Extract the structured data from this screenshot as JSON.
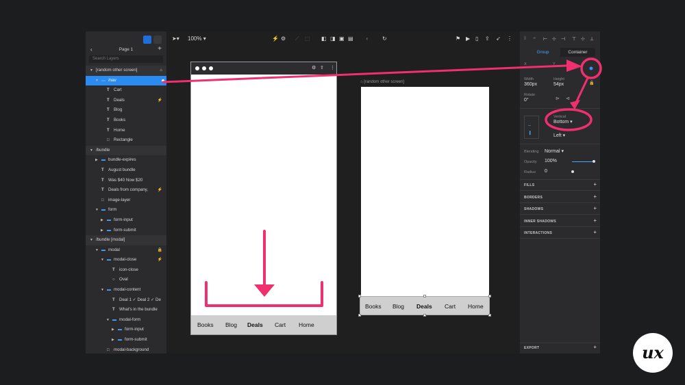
{
  "layers_panel": {
    "page_name": "Page 1",
    "search_placeholder": "Search Layers",
    "rows": [
      {
        "label": "[random other screen]",
        "depth": 0,
        "icon": "",
        "caret": "▼",
        "group": true,
        "badge": "⌂",
        "selected": false
      },
      {
        "label": "/nav",
        "depth": 1,
        "icon": "folder",
        "caret": "▼",
        "group": false,
        "badge": "",
        "selected": true
      },
      {
        "label": "Cart",
        "depth": 2,
        "icon": "T",
        "caret": "",
        "group": false,
        "badge": "",
        "selected": false
      },
      {
        "label": "Deals",
        "depth": 2,
        "icon": "T",
        "caret": "",
        "group": false,
        "badge": "⚡",
        "selected": false
      },
      {
        "label": "Blog",
        "depth": 2,
        "icon": "T",
        "caret": "",
        "group": false,
        "badge": "",
        "selected": false
      },
      {
        "label": "Books",
        "depth": 2,
        "icon": "T",
        "caret": "",
        "group": false,
        "badge": "",
        "selected": false
      },
      {
        "label": "Home",
        "depth": 2,
        "icon": "T",
        "caret": "",
        "group": false,
        "badge": "",
        "selected": false
      },
      {
        "label": "Rectangle",
        "depth": 2,
        "icon": "□",
        "caret": "",
        "group": false,
        "badge": "",
        "selected": false
      },
      {
        "label": "/bundle",
        "depth": 0,
        "icon": "",
        "caret": "▼",
        "group": true,
        "badge": "",
        "selected": false
      },
      {
        "label": "bundle-expires",
        "depth": 1,
        "icon": "folder",
        "caret": "▶",
        "group": false,
        "badge": "",
        "selected": false
      },
      {
        "label": "August bundle",
        "depth": 1,
        "icon": "T",
        "caret": "",
        "group": false,
        "badge": "",
        "selected": false
      },
      {
        "label": "Was $40 Now $20",
        "depth": 1,
        "icon": "T",
        "caret": "",
        "group": false,
        "badge": "",
        "selected": false
      },
      {
        "label": "Deals from company,",
        "depth": 1,
        "icon": "T",
        "caret": "",
        "group": false,
        "badge": "⚡",
        "selected": false
      },
      {
        "label": "image-layer",
        "depth": 1,
        "icon": "□",
        "caret": "",
        "group": false,
        "badge": "",
        "selected": false
      },
      {
        "label": "form",
        "depth": 1,
        "icon": "folder",
        "caret": "▼",
        "group": false,
        "badge": "",
        "selected": false
      },
      {
        "label": "form-input",
        "depth": 2,
        "icon": "folder",
        "caret": "▶",
        "group": false,
        "badge": "",
        "selected": false
      },
      {
        "label": "form-submit",
        "depth": 2,
        "icon": "folder",
        "caret": "▶",
        "group": false,
        "badge": "",
        "selected": false
      },
      {
        "label": "/bundle [modal]",
        "depth": 0,
        "icon": "",
        "caret": "▼",
        "group": true,
        "badge": "",
        "selected": false
      },
      {
        "label": "modal",
        "depth": 1,
        "icon": "folder",
        "caret": "▼",
        "group": false,
        "badge": "🔒",
        "selected": false
      },
      {
        "label": "modal-close",
        "depth": 2,
        "icon": "folder",
        "caret": "▼",
        "group": false,
        "badge": "⚡",
        "selected": false
      },
      {
        "label": "icon-close",
        "depth": 3,
        "icon": "T",
        "caret": "",
        "group": false,
        "badge": "",
        "selected": false
      },
      {
        "label": "Oval",
        "depth": 3,
        "icon": "○",
        "caret": "",
        "group": false,
        "badge": "",
        "selected": false
      },
      {
        "label": "modal-content",
        "depth": 2,
        "icon": "folder",
        "caret": "▼",
        "group": false,
        "badge": "",
        "selected": false
      },
      {
        "label": "Deal 1 ✓ Deal 2 ✓ De",
        "depth": 3,
        "icon": "T",
        "caret": "",
        "group": false,
        "badge": "",
        "selected": false
      },
      {
        "label": "What's in the bundle",
        "depth": 3,
        "icon": "T",
        "caret": "",
        "group": false,
        "badge": "",
        "selected": false
      },
      {
        "label": "modal-form",
        "depth": 3,
        "icon": "folder",
        "caret": "▼",
        "group": false,
        "badge": "",
        "selected": false
      },
      {
        "label": "form-input",
        "depth": 4,
        "icon": "folder",
        "caret": "▶",
        "group": false,
        "badge": "",
        "selected": false
      },
      {
        "label": "form-submit",
        "depth": 4,
        "icon": "folder",
        "caret": "▶",
        "group": false,
        "badge": "",
        "selected": false
      },
      {
        "label": "modal-background",
        "depth": 2,
        "icon": "□",
        "caret": "",
        "group": false,
        "badge": "",
        "selected": false
      }
    ]
  },
  "toolbar": {
    "zoom": "100%"
  },
  "canvas": {
    "artboard2_label": "[random other screen]",
    "nav_items": [
      "Books",
      "Blog",
      "Deals",
      "Cart",
      "Home"
    ],
    "active_nav_item": "Deals"
  },
  "inspector": {
    "tabs": [
      "Group",
      "Container"
    ],
    "active_tab": "Group",
    "x_label": "X",
    "y_label": "Y",
    "width_label": "Width",
    "width_value": "360px",
    "height_label": "Height",
    "height_value": "54px",
    "rotate_label": "Rotate",
    "rotate_value": "0°",
    "vertical_label": "Vertical",
    "vertical_value": "Bottom",
    "horizontal_value": "Left",
    "blending_label": "Blending",
    "blending_value": "Normal",
    "opacity_label": "Opacity",
    "opacity_value": "100%",
    "opacity_level": 1.0,
    "radius_label": "Radius",
    "radius_value": "0",
    "sections": [
      "FILLS",
      "BORDERS",
      "SHADOWS",
      "INNER SHADOWS",
      "INTERACTIONS"
    ],
    "export_label": "EXPORT"
  },
  "colors": {
    "accent": "#2a8cf0",
    "annotation": "#f0306e"
  }
}
